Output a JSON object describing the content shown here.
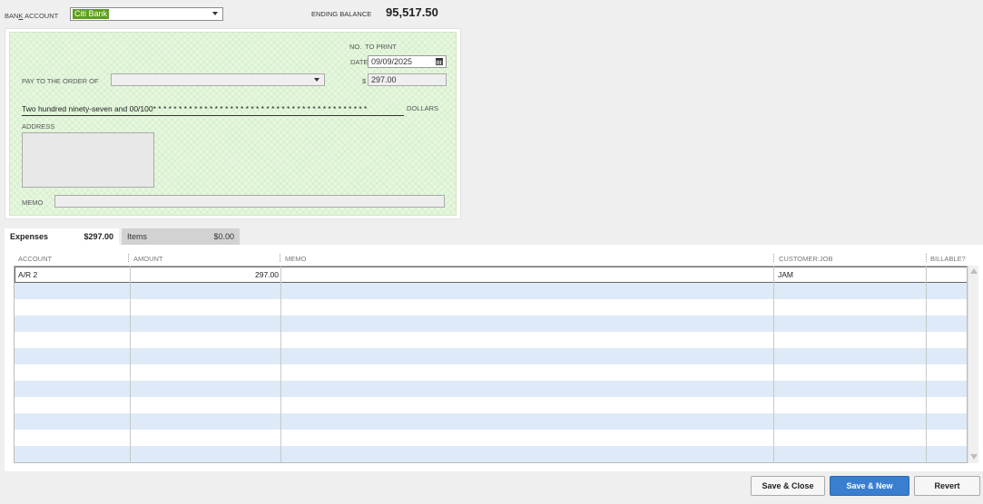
{
  "bank": {
    "label": "BANK ACCOUNT",
    "selected": "Citi Bank",
    "ending_balance_label": "ENDING BALANCE",
    "ending_balance": "95,517.50"
  },
  "check": {
    "no_label": "NO.",
    "no_value": "TO PRINT",
    "date_label": "DATE",
    "date_value": "09/09/2025",
    "payto_label": "PAY TO THE ORDER OF",
    "payto_value": "",
    "dollar_sign": "$",
    "amount": "297.00",
    "amount_words": "Two hundred ninety-seven and 00/100* * * * * * * * * * * * * * * * * * * * * * * * * * * * * * * * * * * * * * * * * *",
    "dollars_label": "DOLLARS",
    "address_label": "ADDRESS",
    "memo_label": "MEMO"
  },
  "tabs": [
    {
      "name": "Expenses",
      "amount": "$297.00"
    },
    {
      "name": "Items",
      "amount": "$0.00"
    }
  ],
  "grid": {
    "columns": [
      "ACCOUNT",
      "AMOUNT",
      "MEMO",
      "CUSTOMER:JOB",
      "BILLABLE?"
    ],
    "rows": [
      {
        "account": "A/R 2",
        "amount": "297.00",
        "memo": "",
        "customer": "JAM",
        "billable": ""
      }
    ]
  },
  "buttons": {
    "save_close": "Save & Close",
    "save_new": "Save & New",
    "revert": "Revert"
  },
  "colors": {
    "bank_highlight": "#5d9e1d",
    "primary_button": "#3a7ed0",
    "row_alt": "#deeaf7",
    "check_bg": "#e6f7df"
  }
}
